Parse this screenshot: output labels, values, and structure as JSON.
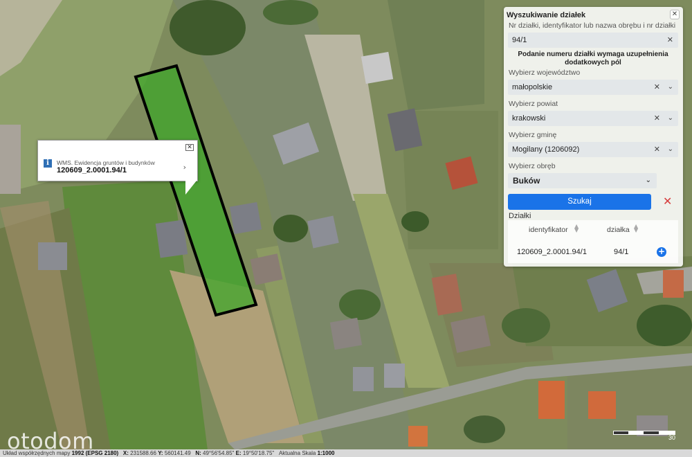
{
  "popup": {
    "source": "WMS. Ewidencja gruntów i budynków",
    "parcel_id": "120609_2.0001.94/1",
    "close_icon": "close-icon",
    "info_icon": "info-icon",
    "chevron_icon": "chevron-right-icon"
  },
  "panel": {
    "title": "Wyszukiwanie działek",
    "query_label": "Nr działki, identyfikator lub nazwa obrębu i nr działki",
    "query_value": "94/1",
    "note": "Podanie numeru działki wymaga uzupełnienia dodatkowych pól",
    "voivodeship_label": "Wybierz województwo",
    "voivodeship_value": "małopolskie",
    "county_label": "Wybierz powiat",
    "county_value": "krakowski",
    "commune_label": "Wybierz gminę",
    "commune_value": "Mogilany (1206092)",
    "precinct_label": "Wybierz obręb",
    "precinct_value": "Buków",
    "search_button": "Szukaj",
    "results_title": "Działki",
    "results_headers": [
      "identyfikator",
      "działka"
    ],
    "results_rows": [
      {
        "id": "120609_2.0001.94/1",
        "parcel": "94/1"
      }
    ],
    "accent_color": "#1a73e8"
  },
  "watermark": "otodom",
  "scale_bar_label": "30",
  "status_bar": {
    "crs_label": "Układ współrzędnych mapy",
    "crs_value": "1992 (EPSG 2180)",
    "x_label": "X:",
    "x_value": "231588.66",
    "y_label": "Y:",
    "y_value": "560141.49",
    "n_label": "N:",
    "n_value": "49°56'54.85\"",
    "e_label": "E:",
    "e_value": "19°50'18.75\"",
    "source": "Aktualna",
    "scale_label": "Skala",
    "scale_value": "1:1000"
  }
}
